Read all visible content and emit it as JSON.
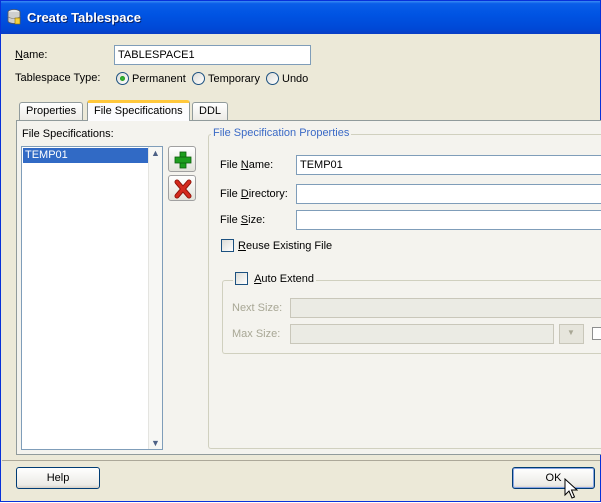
{
  "window": {
    "title": "Create Tablespace",
    "icon": "database-icon"
  },
  "form": {
    "name_label": "Name:",
    "name_value": "TABLESPACE1",
    "type_label": "Tablespace Type:",
    "type_options": [
      {
        "label": "Permanent",
        "selected": true
      },
      {
        "label": "Temporary",
        "selected": false
      },
      {
        "label": "Undo",
        "selected": false
      }
    ]
  },
  "tabs": [
    {
      "label": "Properties",
      "active": false
    },
    {
      "label": "File Specifications",
      "active": true
    },
    {
      "label": "DDL",
      "active": false
    }
  ],
  "file_specs": {
    "list_label": "File Specifications:",
    "items": [
      "TEMP01"
    ],
    "add_icon": "plus-icon",
    "remove_icon": "delete-x-icon"
  },
  "properties": {
    "group_title": "File Specification Properties",
    "file_name_label": "File Name:",
    "file_name_value": "TEMP01",
    "file_directory_label": "File Directory:",
    "file_directory_value": "",
    "file_size_label": "File Size:",
    "file_size_value": "",
    "reuse_label": "Reuse Existing File",
    "reuse_checked": false,
    "auto_extend": {
      "label": "Auto Extend",
      "checked": false,
      "next_size_label": "Next Size:",
      "max_size_label": "Max Size:"
    }
  },
  "buttons": {
    "help": "Help",
    "ok": "OK"
  },
  "colors": {
    "titlebar": "#0054e3",
    "selection": "#316ac5",
    "add_green": "#1e9e1e",
    "delete_red": "#d42a1e",
    "active_tab_accent": "#ffc83c"
  }
}
